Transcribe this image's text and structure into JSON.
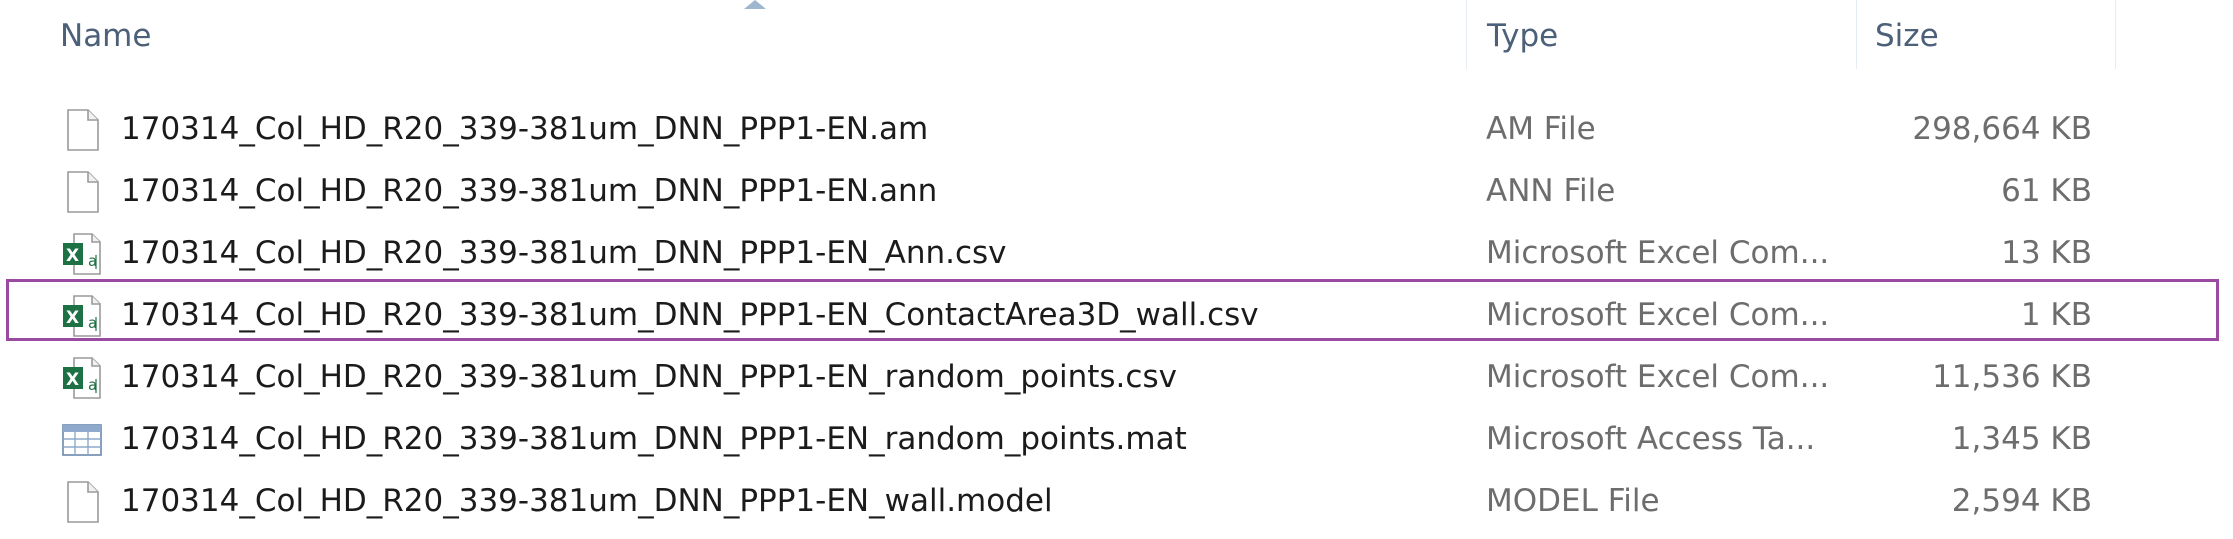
{
  "columns": {
    "name": "Name",
    "type": "Type",
    "size": "Size"
  },
  "files": [
    {
      "name": "170314_Col_HD_R20_339-381um_DNN_PPP1-EN.am",
      "type": "AM File",
      "size": "298,664 KB",
      "icon": "generic-file-icon"
    },
    {
      "name": "170314_Col_HD_R20_339-381um_DNN_PPP1-EN.ann",
      "type": "ANN File",
      "size": "61 KB",
      "icon": "generic-file-icon"
    },
    {
      "name": "170314_Col_HD_R20_339-381um_DNN_PPP1-EN_Ann.csv",
      "type": "Microsoft Excel Com...",
      "size": "13 KB",
      "icon": "excel-csv-icon"
    },
    {
      "name": "170314_Col_HD_R20_339-381um_DNN_PPP1-EN_ContactArea3D_wall.csv",
      "type": "Microsoft Excel Com...",
      "size": "1 KB",
      "icon": "excel-csv-icon",
      "highlighted": true
    },
    {
      "name": "170314_Col_HD_R20_339-381um_DNN_PPP1-EN_random_points.csv",
      "type": "Microsoft Excel Com...",
      "size": "11,536 KB",
      "icon": "excel-csv-icon"
    },
    {
      "name": "170314_Col_HD_R20_339-381um_DNN_PPP1-EN_random_points.mat",
      "type": "Microsoft Access Ta...",
      "size": "1,345 KB",
      "icon": "access-table-icon"
    },
    {
      "name": "170314_Col_HD_R20_339-381um_DNN_PPP1-EN_wall.model",
      "type": "MODEL File",
      "size": "2,594 KB",
      "icon": "generic-file-icon"
    }
  ],
  "colors": {
    "header_text": "#4c607a",
    "name_text": "#1b1b1b",
    "meta_text": "#6d6d6d",
    "highlight_border": "#9a4aa0",
    "excel_green": "#1e7145"
  }
}
